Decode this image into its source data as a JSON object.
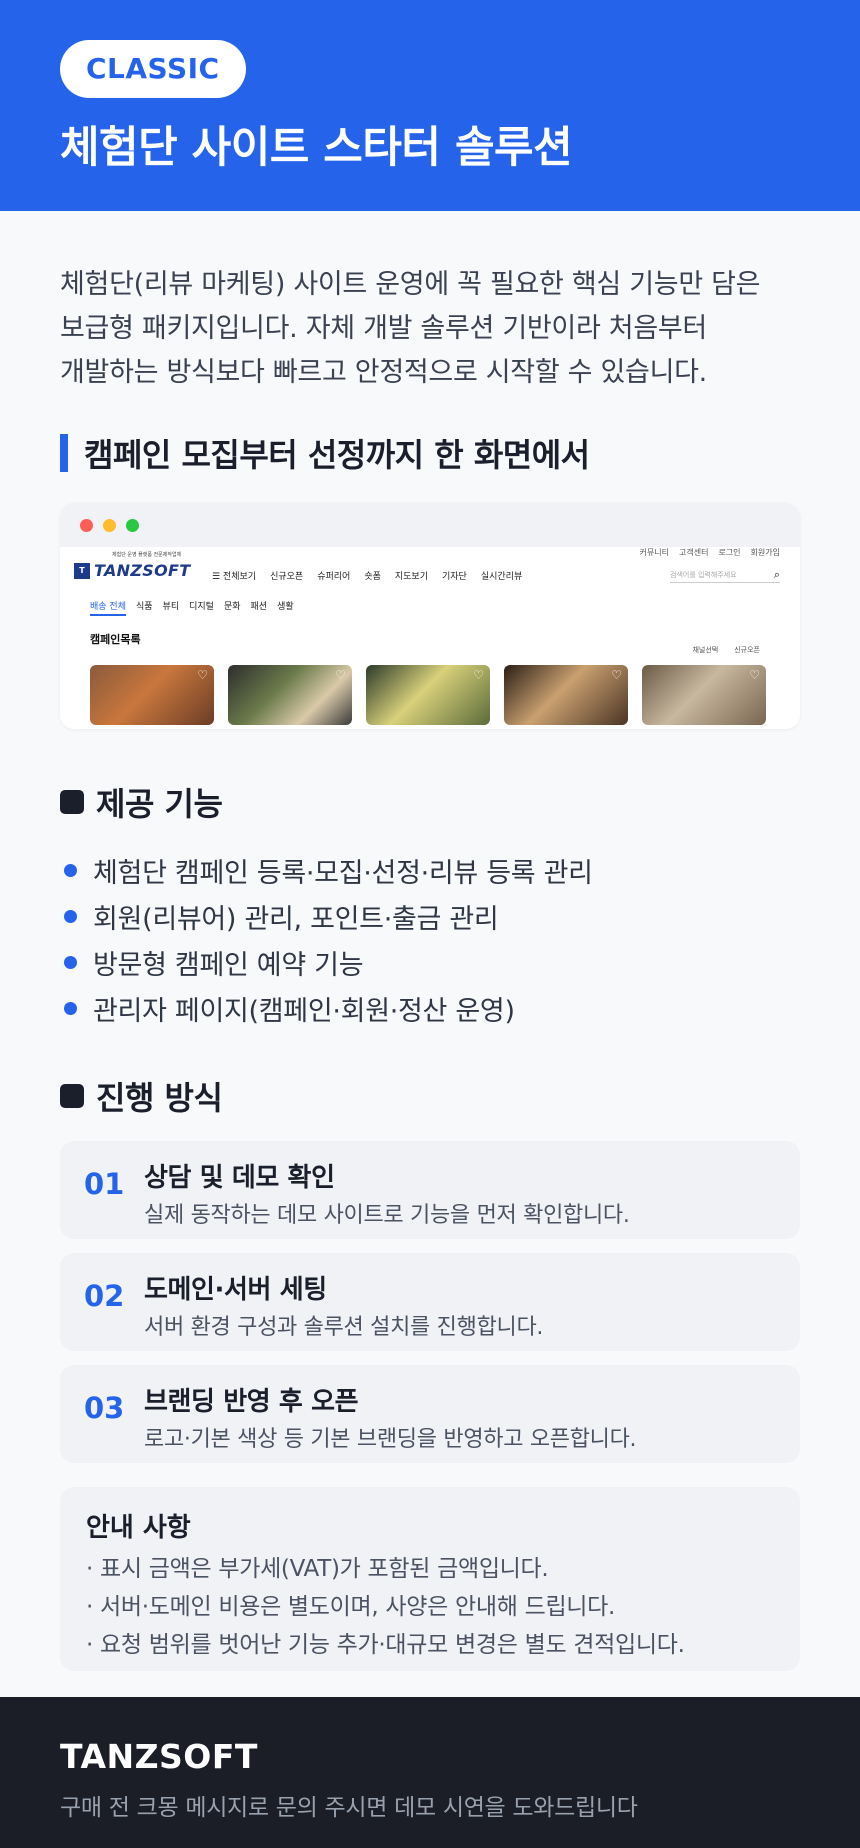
{
  "header": {
    "badge": "CLASSIC",
    "title": "체험단 사이트 스타터 솔루션",
    "bg_color": "#2563eb"
  },
  "intro": {
    "lines": [
      "체험단(리뷰 마케팅) 사이트 운영에 꼭 필요한 핵심 기능만 담은",
      "보급형 패키지입니다. 자체 개발 솔루션 기반이라 처음부터",
      "개발하는 방식보다 빠르고 안정적으로 시작할 수 있습니다."
    ]
  },
  "preview": {
    "title": "캠페인 모집부터 선정까지 한 화면에서",
    "site": {
      "top_links": [
        "커뮤니티",
        "고객센터",
        "로그인",
        "회원가입"
      ],
      "logo": "TANZSOFT",
      "logo_mark": "T",
      "logo_tagline": "체험단 운영 플랫폼 전문제작업체",
      "nav": [
        "☰ 전체보기",
        "신규오픈",
        "슈퍼리어",
        "숏폼",
        "지도보기",
        "기자단",
        "실시간리뷰"
      ],
      "search_placeholder": "검색어를 입력해주세요",
      "categories": [
        "배송 전체",
        "식품",
        "뷰티",
        "디지털",
        "문화",
        "패션",
        "생활"
      ],
      "heading": "캠페인목록",
      "filters": [
        "채널선택",
        "신규오픈"
      ]
    }
  },
  "features": {
    "title": "제공 기능",
    "items": [
      "체험단 캠페인 등록·모집·선정·리뷰 등록 관리",
      "회원(리뷰어) 관리, 포인트·출금 관리",
      "방문형 캠페인 예약 기능",
      "관리자 페이지(캠페인·회원·정산 운영)"
    ]
  },
  "process": {
    "title": "진행 방식",
    "steps": [
      {
        "num": "01",
        "title": "상담 및 데모 확인",
        "desc": "실제 동작하는 데모 사이트로 기능을 먼저 확인합니다."
      },
      {
        "num": "02",
        "title": "도메인·서버 세팅",
        "desc": "서버 환경 구성과 솔루션 설치를 진행합니다."
      },
      {
        "num": "03",
        "title": "브랜딩 반영 후 오픈",
        "desc": "로고·기본 색상 등 기본 브랜딩을 반영하고 오픈합니다."
      }
    ]
  },
  "notice": {
    "title": "안내 사항",
    "items": [
      "· 표시 금액은 부가세(VAT)가 포함된 금액입니다.",
      "· 서버·도메인 비용은 별도이며, 사양은 안내해 드립니다.",
      "· 요청 범위를 벗어난 기능 추가·대규모 변경은 별도 견적입니다."
    ]
  },
  "footer": {
    "brand": "TANZSOFT",
    "text": "구매 전 크몽 메시지로 문의 주시면 데모 시연을 도와드립니다"
  }
}
